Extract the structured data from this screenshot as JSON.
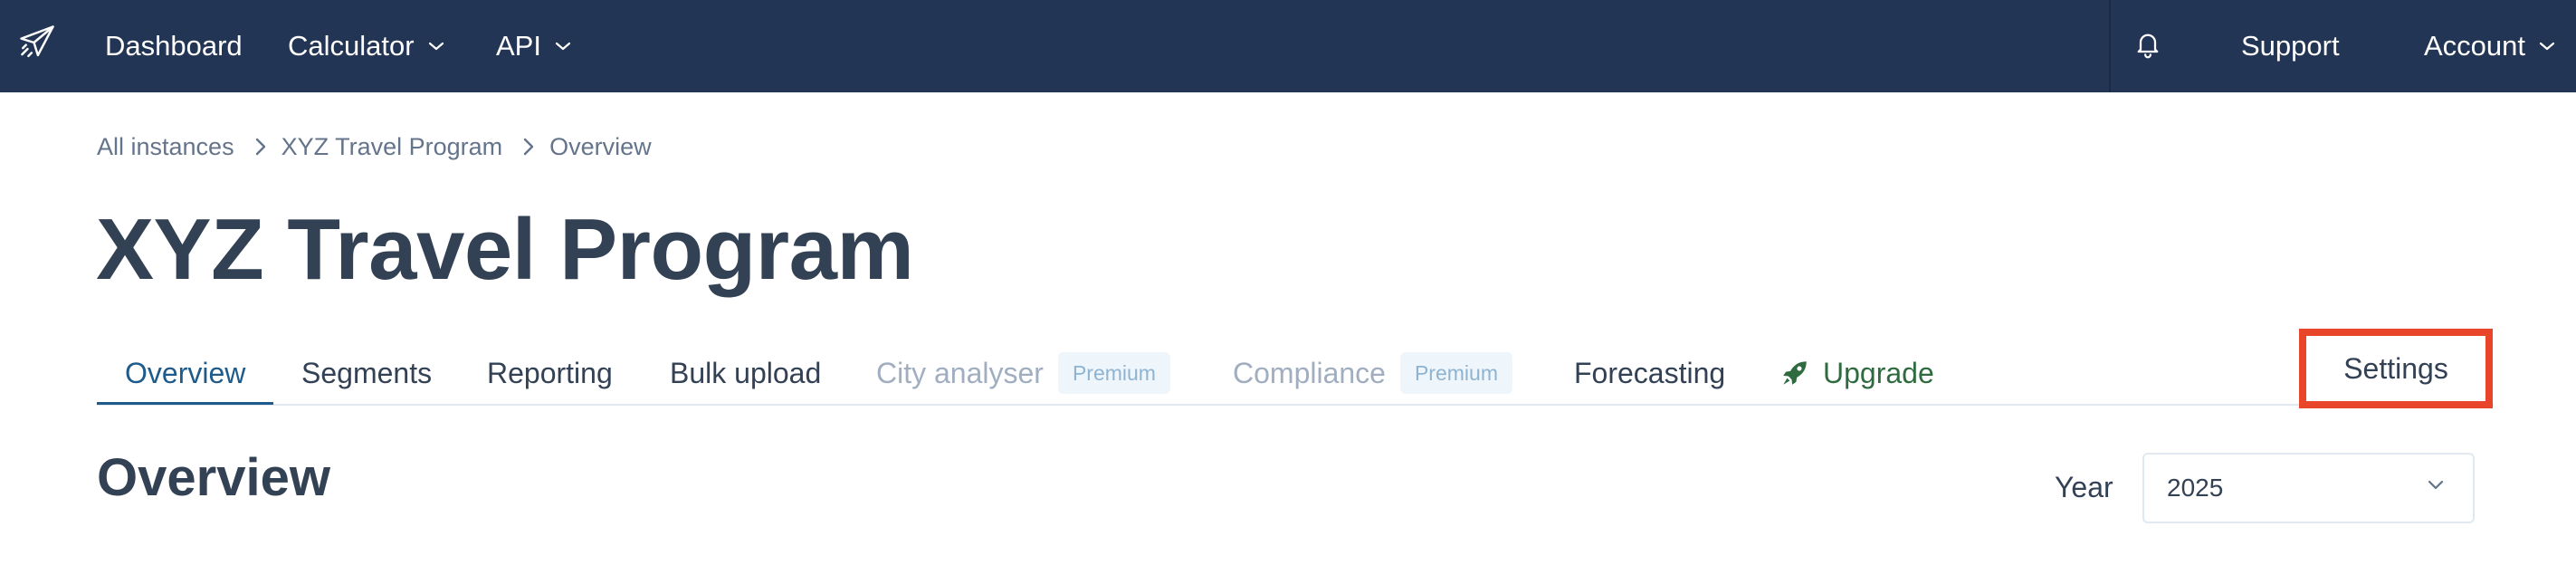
{
  "navbar": {
    "logo_icon": "paper-plane-icon",
    "items": [
      {
        "label": "Dashboard"
      },
      {
        "label": "Calculator",
        "has_dropdown": true
      },
      {
        "label": "API",
        "has_dropdown": true
      }
    ],
    "notifications_icon": "bell-icon",
    "support_label": "Support",
    "account_label": "Account",
    "background_color": "#233554"
  },
  "breadcrumb": [
    {
      "label": "All instances"
    },
    {
      "label": "XYZ Travel Program"
    },
    {
      "label": "Overview"
    }
  ],
  "page_title": "XYZ Travel Program",
  "tabs": [
    {
      "label": "Overview",
      "active": true
    },
    {
      "label": "Segments"
    },
    {
      "label": "Reporting"
    },
    {
      "label": "Bulk upload"
    },
    {
      "label": "City analyser",
      "disabled": true,
      "badge": "Premium"
    },
    {
      "label": "Compliance",
      "disabled": true,
      "badge": "Premium"
    },
    {
      "label": "Forecasting"
    },
    {
      "label": "Upgrade",
      "icon": "rocket-icon",
      "color": "#2f6b3f"
    }
  ],
  "settings_label": "Settings",
  "highlight_color": "#e8452a",
  "section": {
    "title": "Overview",
    "year_label": "Year",
    "year_value": "2025"
  }
}
